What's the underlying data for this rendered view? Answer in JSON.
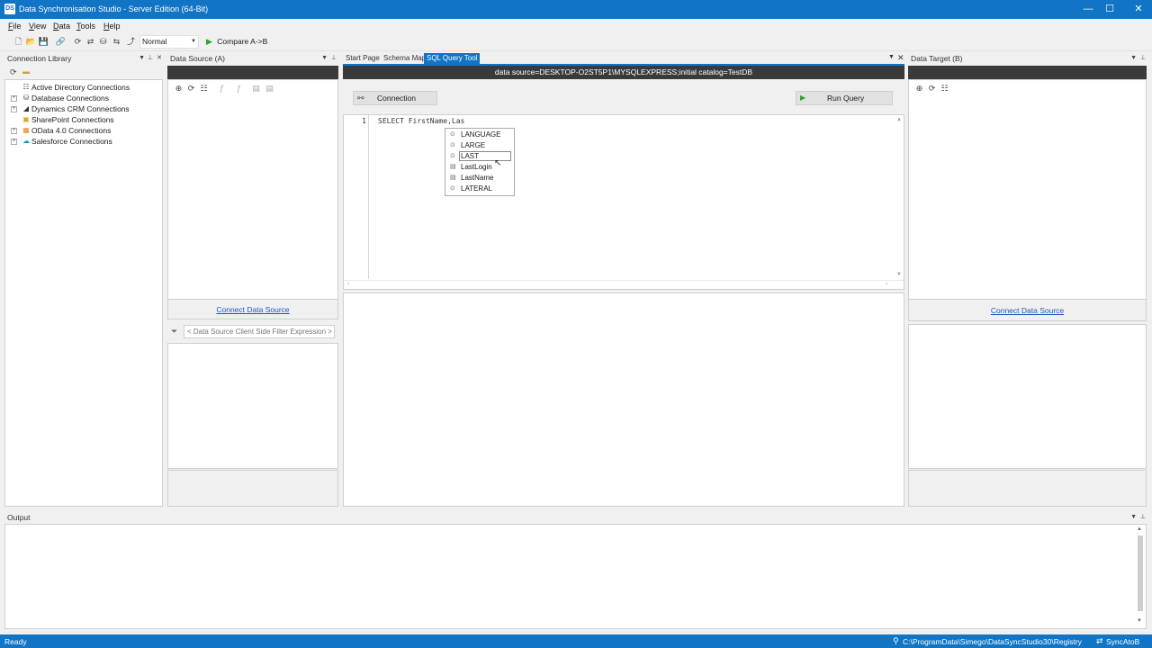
{
  "window": {
    "title": "Data Synchronisation Studio - Server Edition (64-Bit)",
    "app_icon": "DS",
    "minimize": "—",
    "maximize": "☐",
    "close": "✕"
  },
  "menu": [
    "File",
    "View",
    "Data",
    "Tools",
    "Help"
  ],
  "toolbar": {
    "mode_value": "Normal",
    "compare_label": "Compare A->B"
  },
  "connection_library": {
    "title": "Connection Library",
    "items": [
      {
        "label": "Active Directory Connections",
        "icon": "ad-icon"
      },
      {
        "label": "Database Connections",
        "icon": "database-icon"
      },
      {
        "label": "Dynamics CRM Connections",
        "icon": "dynamics-icon"
      },
      {
        "label": "SharePoint Connections",
        "icon": "sharepoint-icon"
      },
      {
        "label": "OData 4.0 Connections",
        "icon": "odata-icon"
      },
      {
        "label": "Salesforce Connections",
        "icon": "salesforce-icon"
      }
    ]
  },
  "data_source": {
    "title": "Data Source (A)",
    "connect_link": "Connect Data Source",
    "filter_placeholder": "< Data Source Client Side Filter Expression >"
  },
  "tabs": [
    {
      "label": "Start Page",
      "active": false
    },
    {
      "label": "Schema Map",
      "active": false
    },
    {
      "label": "SQL Query Tool",
      "active": true
    }
  ],
  "sql_tool": {
    "connection_string": "data source=DESKTOP-O2ST5P1\\MYSQLEXPRESS;initial catalog=TestDB",
    "connection_button": "Connection",
    "run_query_button": "Run Query",
    "line_number": "1",
    "query_text": "SELECT FirstName,Las",
    "autocomplete": [
      {
        "label": "LANGUAGE",
        "kind": "keyword",
        "selected": false
      },
      {
        "label": "LARGE",
        "kind": "keyword",
        "selected": false
      },
      {
        "label": "LAST",
        "kind": "keyword",
        "selected": true
      },
      {
        "label": "LastLogin",
        "kind": "column",
        "selected": false
      },
      {
        "label": "LastName",
        "kind": "column",
        "selected": false
      },
      {
        "label": "LATERAL",
        "kind": "keyword",
        "selected": false
      }
    ]
  },
  "data_target": {
    "title": "Data Target (B)",
    "connect_link": "Connect Data Source"
  },
  "output": {
    "title": "Output"
  },
  "status": {
    "left": "Ready",
    "path": "C:\\ProgramData\\Simego\\DataSyncStudio30\\Registry",
    "sync": "SyncAtoB"
  },
  "colors": {
    "accent": "#1174c4",
    "dark_header": "#3a3a3a",
    "link": "#1a56c4"
  }
}
